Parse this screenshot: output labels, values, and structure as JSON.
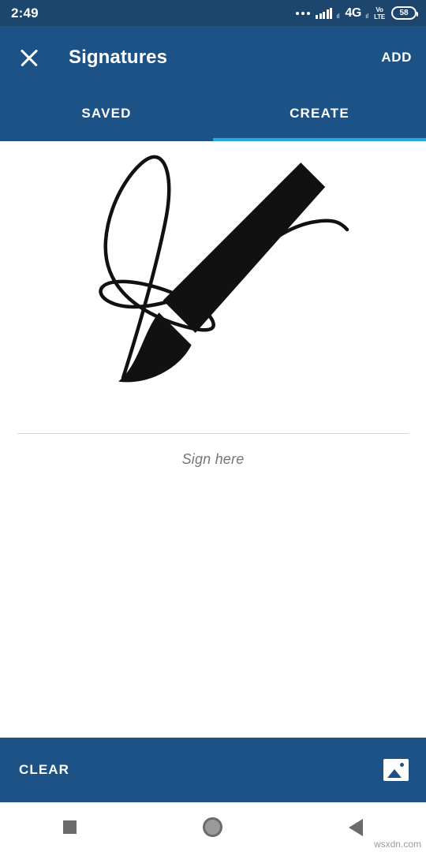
{
  "status_bar": {
    "time": "2:49",
    "network_label": "4G",
    "volte_line1": "Vo",
    "volte_line2": "LTE",
    "battery_percent": "58"
  },
  "appbar": {
    "close_icon": "close-icon",
    "title": "Signatures",
    "action_label": "ADD",
    "tabs": [
      {
        "label": "SAVED",
        "active": false
      },
      {
        "label": "CREATE",
        "active": true
      }
    ]
  },
  "canvas": {
    "hint_text": "Sign here",
    "brush_icon": "brush-icon"
  },
  "bottom_bar": {
    "clear_label": "CLEAR",
    "image_icon": "image-icon"
  },
  "navbar": {
    "recents_icon": "square-recents-icon",
    "home_icon": "circle-home-icon",
    "back_icon": "triangle-back-icon"
  },
  "watermark": "wsxdn.com",
  "colors": {
    "status_bar": "#1d466e",
    "app_bar": "#1d5286",
    "tab_indicator": "#2aa9e0",
    "ink": "#111111"
  }
}
